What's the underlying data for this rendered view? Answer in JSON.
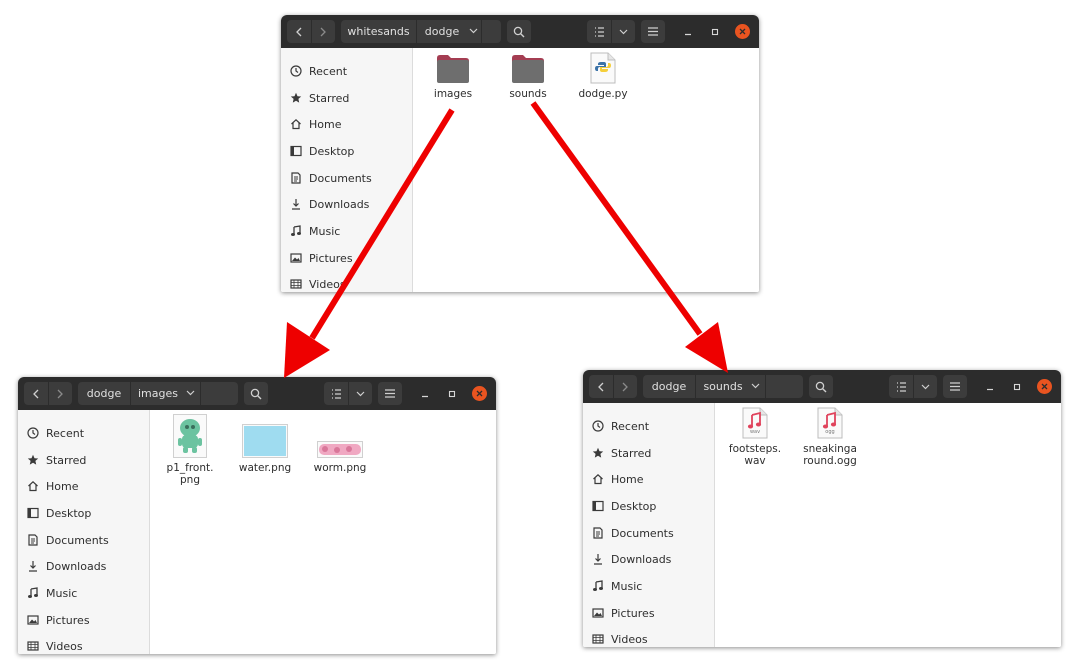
{
  "colors": {
    "headerbar": "#2c2c2c",
    "button": "#3c3c3c",
    "close": "#e95420",
    "folder": "#6e6e6e",
    "folder_tab": "#a43d52",
    "arrow": "#ee0000"
  },
  "sidebar_items": [
    "Recent",
    "Starred",
    "Home",
    "Desktop",
    "Documents",
    "Downloads",
    "Music",
    "Pictures",
    "Videos"
  ],
  "sidebar_icons": [
    "clock-icon",
    "star-icon",
    "home-icon",
    "desktop-icon",
    "documents-icon",
    "downloads-icon",
    "music-icon",
    "pictures-icon",
    "videos-icon"
  ],
  "windows": {
    "top": {
      "breadcrumb": [
        "whitesands",
        "dodge"
      ],
      "files": [
        {
          "name": "images",
          "icon": "folder-icon"
        },
        {
          "name": "sounds",
          "icon": "folder-icon"
        },
        {
          "name": "dodge.py",
          "icon": "python-file-icon"
        }
      ]
    },
    "left": {
      "breadcrumb": [
        "dodge",
        "images"
      ],
      "files": [
        {
          "name": "p1_front.png",
          "icon": "alien-image-icon"
        },
        {
          "name": "water.png",
          "icon": "water-image-icon"
        },
        {
          "name": "worm.png",
          "icon": "worm-image-icon"
        }
      ]
    },
    "right": {
      "breadcrumb": [
        "dodge",
        "sounds"
      ],
      "files": [
        {
          "name": "footsteps.wav",
          "icon": "audio-file-icon",
          "badge": "wav"
        },
        {
          "name": "sneakingaround.ogg",
          "icon": "audio-file-icon",
          "badge": "ogg"
        }
      ]
    }
  }
}
